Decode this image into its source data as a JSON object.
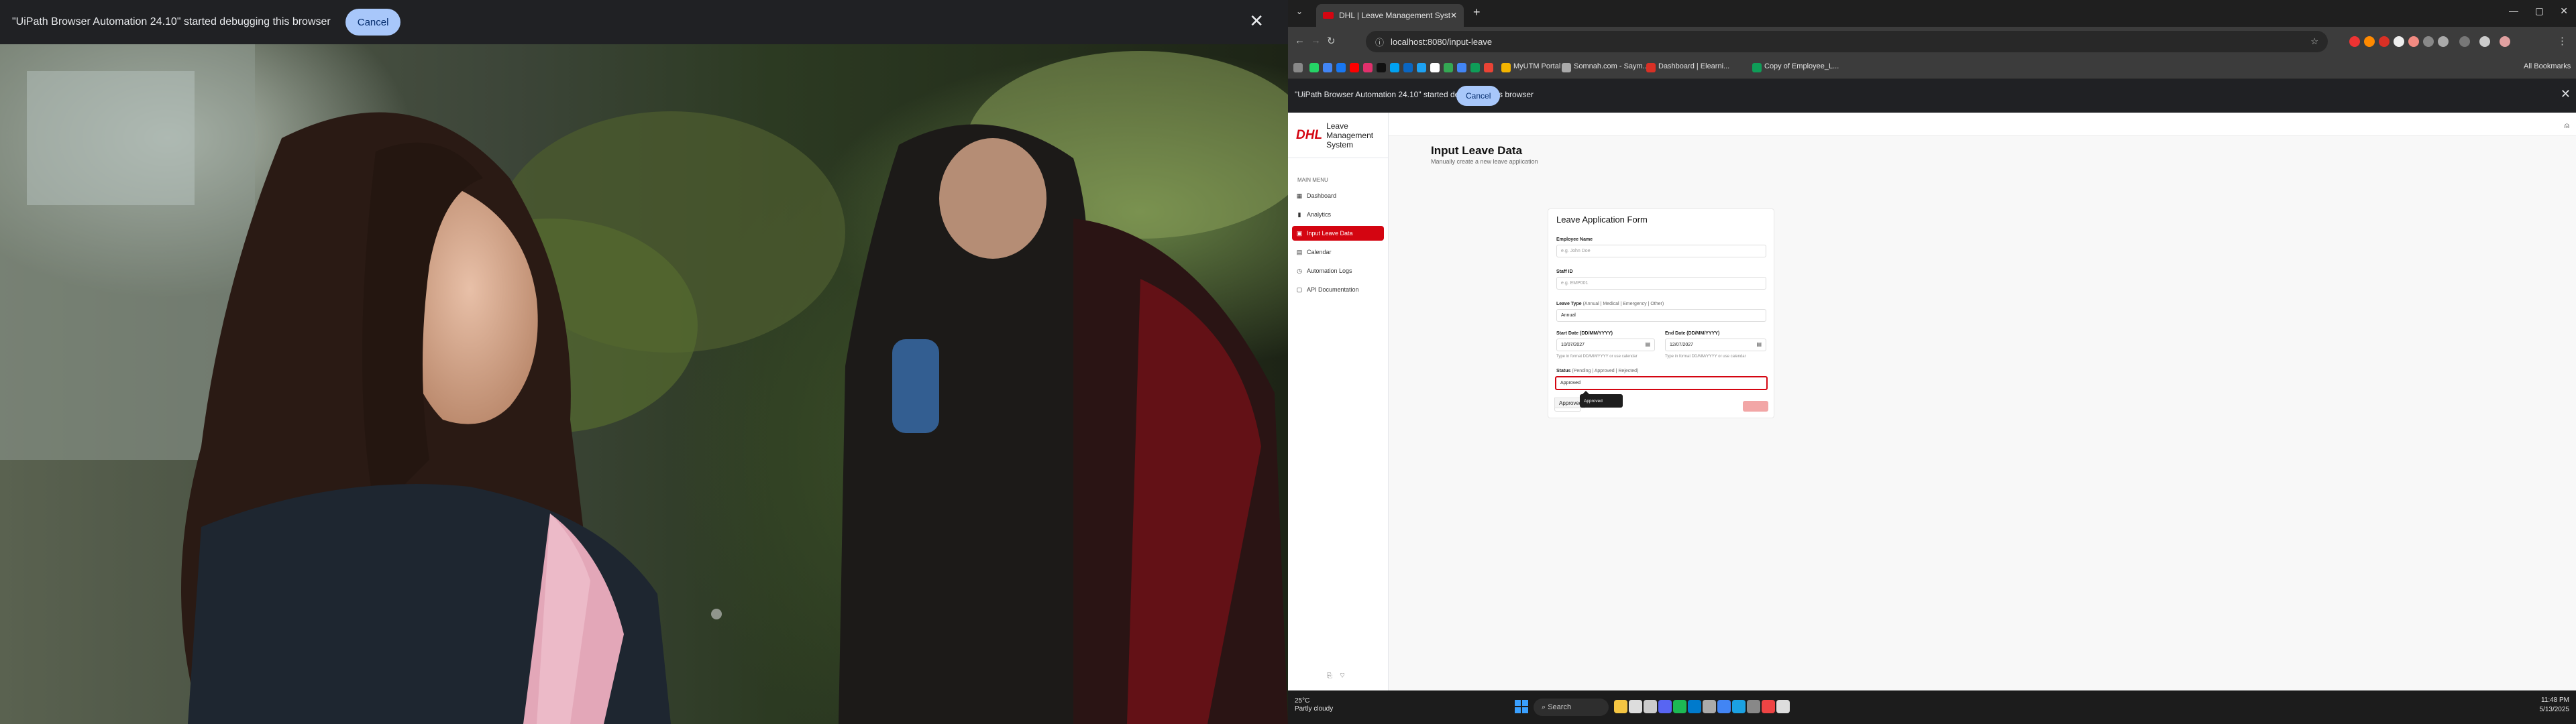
{
  "left_debug": {
    "message": "\"UiPath Browser Automation 24.10\" started debugging this browser",
    "cancel_label": "Cancel",
    "close_glyph": "✕"
  },
  "browser": {
    "tab_title": "DHL | Leave Management Syste",
    "url": "localhost:8080/input-leave",
    "tab_close_glyph": "✕",
    "new_tab_glyph": "+",
    "bookmarks": [
      "MyUTM Portal",
      "Somnah.com - Saym...",
      "Dashboard | Elearni...",
      "Copy of Employee_L..."
    ],
    "all_bookmarks": "All Bookmarks",
    "debug_message": "\"UiPath Browser Automation 24.10\" started debugging this browser",
    "debug_cancel": "Cancel"
  },
  "app": {
    "logo": "DHL",
    "name": "Leave Management System",
    "menu_title": "MAIN MENU",
    "menu": [
      {
        "label": "Dashboard",
        "icon": "dashboard-icon"
      },
      {
        "label": "Analytics",
        "icon": "analytics-icon"
      },
      {
        "label": "Input Leave Data",
        "icon": "input-leave-icon"
      },
      {
        "label": "Calendar",
        "icon": "calendar-icon"
      },
      {
        "label": "Automation Logs",
        "icon": "clock-icon"
      },
      {
        "label": "API Documentation",
        "icon": "document-icon"
      }
    ],
    "active_menu_index": 2
  },
  "page": {
    "title": "Input Leave Data",
    "subtitle": "Manually create a new leave application",
    "form_title": "Leave Application Form",
    "fields": {
      "employee_name": {
        "label": "Employee Name",
        "placeholder": "e.g. John Doe",
        "value": ""
      },
      "staff_id": {
        "label": "Staff ID",
        "placeholder": "e.g. EMP001",
        "value": ""
      },
      "leave_type": {
        "label": "Leave Type",
        "hint": "(Annual | Medical | Emergency | Other)",
        "value": "Annual"
      },
      "start_date": {
        "label": "Start Date (DD/MM/YYYY)",
        "value": "10/07/2027",
        "note": "Type in format DD/MM/YYYY or use calendar"
      },
      "end_date": {
        "label": "End Date (DD/MM/YYYY)",
        "value": "12/07/2027",
        "note": "Type in format DD/MM/YYYY or use calendar"
      },
      "status": {
        "label": "Status",
        "hint": "(Pending | Approved | Rejected)",
        "value": "Approved"
      }
    },
    "autocomplete_option": "Approved",
    "tooltip_text": "Approved"
  },
  "taskbar": {
    "weather_temp": "25°C",
    "weather_desc": "Partly cloudy",
    "search_label": "Search",
    "time": "11:48 PM",
    "date": "5/13/2025"
  },
  "colors": {
    "brand_red": "#d40511",
    "active_menu_bg": "#d40511",
    "cancel_pill": "#a8c7fa"
  }
}
